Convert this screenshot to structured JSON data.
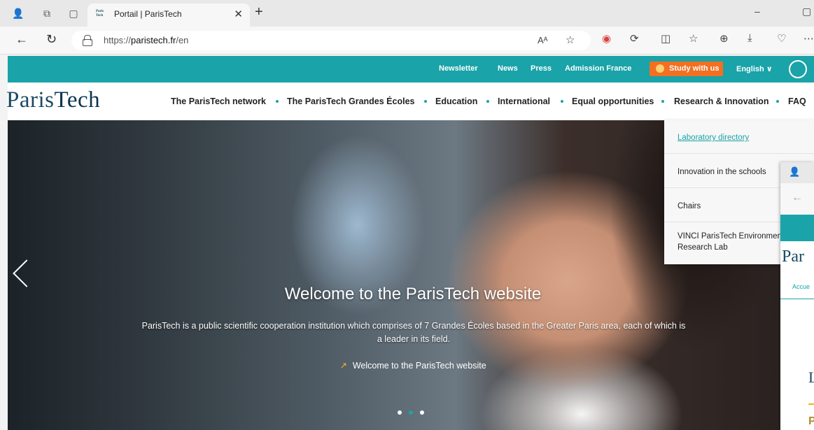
{
  "browser": {
    "tab_title": "Portail | ParisTech",
    "tab_favicon_text": "Paris Tech",
    "url_prefix": "https://",
    "url_domain": "paristech.fr",
    "url_path": "/en",
    "reader_mode_label": "Aᴬ"
  },
  "topbar": {
    "links": [
      "Newsletter",
      "News",
      "Press",
      "Admission France"
    ],
    "study_button": "Study with us",
    "language": "English ∨",
    "accent_color": "#1aa3a8",
    "study_color": "#f36f21"
  },
  "logo": {
    "part1": "Paris",
    "part2": "Tech"
  },
  "nav": {
    "items": [
      "The ParisTech network",
      "The ParisTech Grandes Écoles",
      "Education",
      "International",
      "Equal opportunities",
      "Research & Innovation",
      "FAQ"
    ]
  },
  "hero": {
    "title": "Welcome to the ParisTech website",
    "text": "ParisTech is a public scientific cooperation institution which comprises of 7 Grandes Écoles based in the Greater Paris area, each of which is a leader in its field.",
    "link": "Welcome to the ParisTech website"
  },
  "dropdown": {
    "items": [
      "Laboratory directory",
      "Innovation in the schools",
      "Chairs",
      "VINCI ParisTech Environment Research Lab"
    ]
  },
  "window2": {
    "logo_fragment": "Par",
    "breadcrumb_fragment": "Accue",
    "heading_fragment": "L",
    "text_fragment": "P"
  }
}
